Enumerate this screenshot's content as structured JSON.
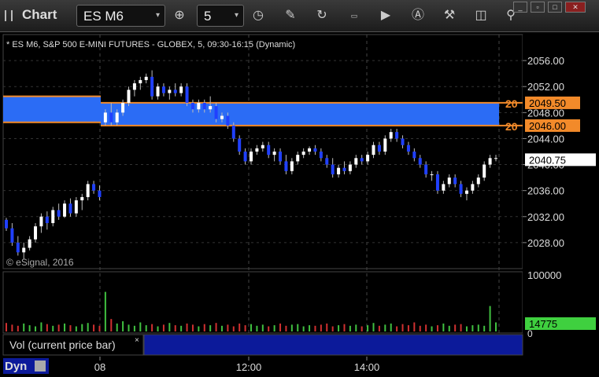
{
  "window": {
    "title": "Chart"
  },
  "toolbar": {
    "symbol": "ES M6",
    "interval": "5",
    "buttons": [
      "cursor-icon",
      "draw-icon",
      "refresh-icon",
      "studies-icon",
      "play-icon",
      "alert-icon",
      "tools-icon",
      "marker-icon",
      "link-icon"
    ]
  },
  "chart_data": {
    "type": "candlestick",
    "title": "* ES M6, S&P 500 E-MINI FUTURES - GLOBEX, 5, 09:30-16:15 (Dynamic)",
    "copyright": "© eSignal, 2016",
    "price_ticks": [
      "2056.00",
      "2052.00",
      "2048.00",
      "2044.00",
      "2040.00",
      "2036.00",
      "2032.00",
      "2028.00"
    ],
    "price_tick_values": [
      2056,
      2052,
      2048,
      2044,
      2040,
      2036,
      2032,
      2028
    ],
    "ylim": [
      2024,
      2060
    ],
    "time_ticks": [
      "08",
      "12:00",
      "14:00"
    ],
    "zones": [
      {
        "label": "20",
        "price_label": "2049.50",
        "top": 2049.5,
        "bottom": 2046.0,
        "price_label2": "2046.00"
      }
    ],
    "last_price": "2040.75",
    "candles": [
      [
        2031.5,
        2031.8,
        2029.8,
        2030.2
      ],
      [
        2030.2,
        2031.0,
        2027.5,
        2028.0
      ],
      [
        2028.0,
        2029.0,
        2026.0,
        2026.5
      ],
      [
        2026.5,
        2028.0,
        2025.5,
        2027.2
      ],
      [
        2027.2,
        2029.0,
        2026.8,
        2028.5
      ],
      [
        2028.5,
        2031.0,
        2028.0,
        2030.5
      ],
      [
        2030.5,
        2032.5,
        2029.5,
        2032.0
      ],
      [
        2032.0,
        2032.8,
        2030.0,
        2031.0
      ],
      [
        2031.0,
        2033.5,
        2030.5,
        2033.0
      ],
      [
        2033.0,
        2034.0,
        2031.5,
        2032.0
      ],
      [
        2032.0,
        2034.5,
        2031.8,
        2034.0
      ],
      [
        2034.0,
        2034.8,
        2032.0,
        2032.5
      ],
      [
        2032.5,
        2035.0,
        2032.0,
        2034.5
      ],
      [
        2034.5,
        2035.5,
        2033.0,
        2035.0
      ],
      [
        2035.0,
        2037.5,
        2034.5,
        2037.0
      ],
      [
        2037.0,
        2037.5,
        2035.5,
        2036.0
      ],
      [
        2036.0,
        2036.8,
        2034.5,
        2035.0
      ],
      [
        2046.5,
        2048.5,
        2046.0,
        2048.0
      ],
      [
        2048.0,
        2049.5,
        2046.0,
        2046.5
      ],
      [
        2046.5,
        2048.5,
        2046.0,
        2048.0
      ],
      [
        2048.0,
        2050.0,
        2047.5,
        2049.5
      ],
      [
        2049.5,
        2052.0,
        2049.0,
        2051.5
      ],
      [
        2051.5,
        2053.0,
        2050.5,
        2052.5
      ],
      [
        2052.5,
        2053.5,
        2051.5,
        2053.0
      ],
      [
        2053.0,
        2054.0,
        2052.5,
        2053.5
      ],
      [
        2053.5,
        2054.5,
        2050.0,
        2050.5
      ],
      [
        2050.5,
        2052.5,
        2050.0,
        2052.0
      ],
      [
        2052.0,
        2052.5,
        2050.5,
        2051.0
      ],
      [
        2051.0,
        2052.0,
        2050.0,
        2051.5
      ],
      [
        2051.5,
        2052.5,
        2050.5,
        2051.0
      ],
      [
        2051.0,
        2052.5,
        2050.5,
        2052.0
      ],
      [
        2052.0,
        2052.5,
        2049.0,
        2049.5
      ],
      [
        2049.5,
        2050.0,
        2048.0,
        2048.5
      ],
      [
        2048.5,
        2050.0,
        2048.0,
        2049.5
      ],
      [
        2049.5,
        2050.0,
        2048.0,
        2048.5
      ],
      [
        2048.5,
        2050.5,
        2048.0,
        2049.0
      ],
      [
        2049.0,
        2049.5,
        2046.5,
        2047.0
      ],
      [
        2047.0,
        2048.0,
        2046.5,
        2047.5
      ],
      [
        2047.5,
        2048.0,
        2045.5,
        2046.0
      ],
      [
        2046.0,
        2046.5,
        2043.5,
        2044.0
      ],
      [
        2044.0,
        2044.5,
        2041.5,
        2042.0
      ],
      [
        2042.0,
        2042.5,
        2040.0,
        2040.5
      ],
      [
        2040.5,
        2042.5,
        2040.0,
        2042.0
      ],
      [
        2042.0,
        2043.0,
        2041.5,
        2042.5
      ],
      [
        2042.5,
        2043.5,
        2042.0,
        2043.0
      ],
      [
        2043.0,
        2043.5,
        2041.0,
        2041.5
      ],
      [
        2041.5,
        2042.5,
        2040.5,
        2042.0
      ],
      [
        2042.0,
        2042.5,
        2040.0,
        2040.5
      ],
      [
        2040.5,
        2041.5,
        2038.5,
        2039.0
      ],
      [
        2039.0,
        2041.0,
        2038.5,
        2040.5
      ],
      [
        2040.5,
        2042.0,
        2040.0,
        2041.5
      ],
      [
        2041.5,
        2042.5,
        2041.0,
        2042.0
      ],
      [
        2042.0,
        2042.8,
        2041.5,
        2042.5
      ],
      [
        2042.5,
        2043.0,
        2041.5,
        2042.0
      ],
      [
        2042.0,
        2042.5,
        2040.5,
        2041.0
      ],
      [
        2041.0,
        2041.5,
        2039.5,
        2040.0
      ],
      [
        2040.0,
        2041.0,
        2038.0,
        2038.5
      ],
      [
        2038.5,
        2040.0,
        2038.0,
        2039.5
      ],
      [
        2039.5,
        2040.5,
        2038.5,
        2039.0
      ],
      [
        2039.0,
        2040.5,
        2038.5,
        2040.0
      ],
      [
        2040.0,
        2041.5,
        2039.5,
        2041.0
      ],
      [
        2041.0,
        2041.5,
        2040.0,
        2040.5
      ],
      [
        2040.5,
        2042.0,
        2040.0,
        2041.5
      ],
      [
        2041.5,
        2043.5,
        2041.0,
        2043.0
      ],
      [
        2043.0,
        2043.5,
        2041.5,
        2042.0
      ],
      [
        2042.0,
        2044.5,
        2041.5,
        2044.0
      ],
      [
        2044.0,
        2045.5,
        2043.5,
        2045.0
      ],
      [
        2045.0,
        2045.5,
        2043.5,
        2044.0
      ],
      [
        2044.0,
        2044.5,
        2042.5,
        2043.0
      ],
      [
        2043.0,
        2043.5,
        2041.5,
        2042.0
      ],
      [
        2042.0,
        2042.5,
        2040.5,
        2041.0
      ],
      [
        2041.0,
        2041.5,
        2039.5,
        2040.0
      ],
      [
        2040.0,
        2040.5,
        2038.0,
        2038.5
      ],
      [
        2038.5,
        2039.0,
        2037.5,
        2038.5
      ],
      [
        2038.5,
        2039.0,
        2035.5,
        2036.0
      ],
      [
        2036.0,
        2037.5,
        2035.5,
        2037.0
      ],
      [
        2037.0,
        2038.5,
        2036.5,
        2038.0
      ],
      [
        2038.0,
        2038.5,
        2036.5,
        2037.0
      ],
      [
        2037.0,
        2037.5,
        2035.0,
        2035.5
      ],
      [
        2035.5,
        2036.5,
        2034.5,
        2036.0
      ],
      [
        2036.0,
        2037.5,
        2035.5,
        2037.0
      ],
      [
        2037.0,
        2038.5,
        2036.5,
        2038.0
      ],
      [
        2038.0,
        2040.5,
        2037.5,
        2040.0
      ],
      [
        2040.0,
        2041.5,
        2039.5,
        2041.0
      ],
      [
        2041.0,
        2041.5,
        2040.5,
        2041.0
      ]
    ],
    "volume_pane": {
      "title": "Vol (current price bar)",
      "ticks": [
        "100000",
        "0"
      ],
      "last_value": "14775",
      "values": [
        15,
        12,
        10,
        14,
        11,
        9,
        16,
        13,
        10,
        12,
        14,
        11,
        9,
        13,
        15,
        12,
        10,
        70,
        22,
        14,
        18,
        12,
        10,
        16,
        11,
        13,
        9,
        12,
        15,
        11,
        10,
        14,
        12,
        9,
        13,
        11,
        15,
        10,
        12,
        9,
        14,
        11,
        13,
        10,
        12,
        9,
        11,
        14,
        10,
        12,
        13,
        9,
        11,
        10,
        12,
        14,
        9,
        11,
        13,
        10,
        12,
        9,
        11,
        15,
        10,
        12,
        14,
        9,
        13,
        11,
        16,
        10,
        12,
        9,
        11,
        14,
        10,
        12,
        13,
        9,
        11,
        12,
        10,
        45,
        16
      ]
    },
    "status_label": "Dyn"
  }
}
